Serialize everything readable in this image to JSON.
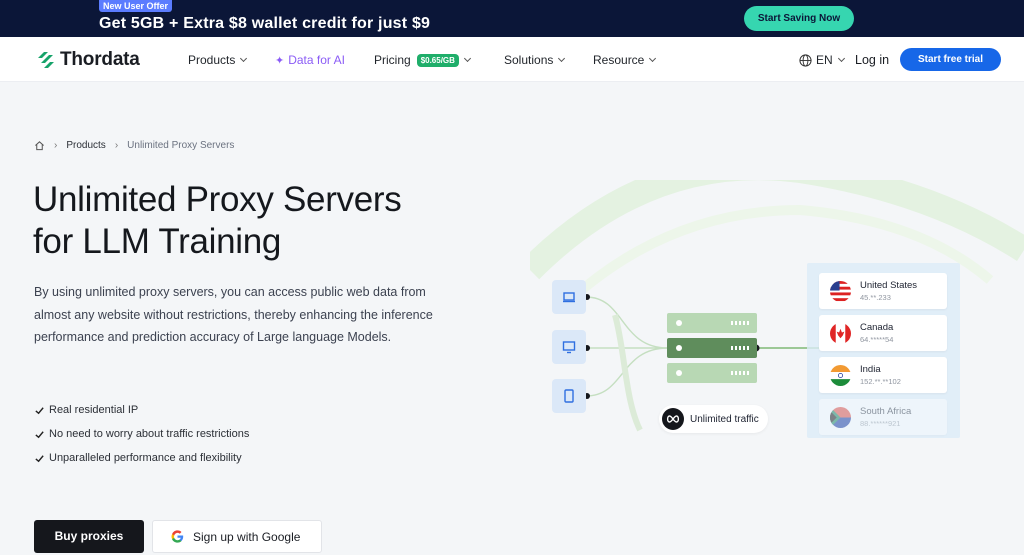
{
  "promo": {
    "badge": "New User Offer",
    "text": "Get 5GB + Extra $8 wallet credit for just $9",
    "cta": "Start Saving Now"
  },
  "nav": {
    "brand": "Thordata",
    "items": [
      {
        "label": "Products"
      },
      {
        "label": "Data for AI"
      },
      {
        "label": "Pricing",
        "badge": "$0.65/GB"
      },
      {
        "label": "Solutions"
      },
      {
        "label": "Resource"
      }
    ],
    "language": "EN",
    "login": "Log in",
    "trial": "Start free trial"
  },
  "breadcrumb": {
    "items": [
      "Products",
      "Unlimited Proxy Servers"
    ]
  },
  "hero": {
    "title_line1": "Unlimited Proxy Servers",
    "title_line2": "for LLM Training",
    "description": "By using unlimited proxy servers, you can access public web data from almost any website without restrictions, thereby enhancing the inference performance and prediction accuracy of Large language Models.",
    "features": [
      "Real residential IP",
      "No need to worry about traffic restrictions",
      "Unparalleled performance and flexibility"
    ],
    "buy_button": "Buy proxies",
    "google_button": "Sign up with Google"
  },
  "illustration": {
    "traffic_label": "Unlimited traffic",
    "countries": [
      {
        "name": "United States",
        "ip": "45.**.233"
      },
      {
        "name": "Canada",
        "ip": "64.*****54"
      },
      {
        "name": "India",
        "ip": "152.**.**102"
      },
      {
        "name": "South Africa",
        "ip": "88.******921"
      }
    ]
  },
  "colors": {
    "banner_bg": "#0b1638",
    "banner_cta": "#36d6b0",
    "primary_blue": "#1767e8",
    "price_badge": "#1fae6a",
    "ai_purple": "#8b5cf6",
    "server_active": "#5f8d5c",
    "server_idle": "#b8d8b4"
  }
}
